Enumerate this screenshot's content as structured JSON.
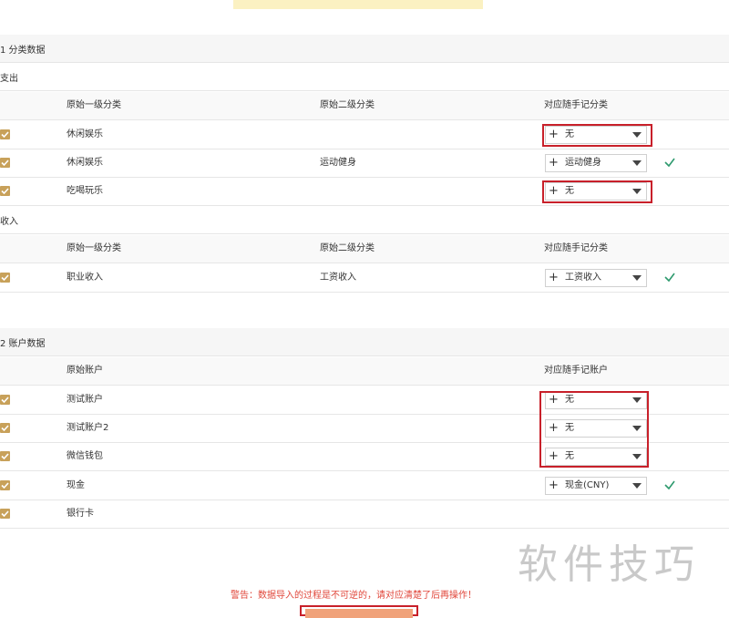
{
  "categories_section": {
    "title": "1 分类数据",
    "expense": {
      "group_label": "支出",
      "headers": [
        "原始一级分类",
        "原始二级分类",
        "对应随手记分类"
      ],
      "rows": [
        {
          "level1": "休闲娱乐",
          "level2": "",
          "mapped": "无",
          "matched": false
        },
        {
          "level1": "休闲娱乐",
          "level2": "运动健身",
          "mapped": "运动健身",
          "matched": true
        },
        {
          "level1": "吃喝玩乐",
          "level2": "",
          "mapped": "无",
          "matched": false
        }
      ]
    },
    "income": {
      "group_label": "收入",
      "headers": [
        "原始一级分类",
        "原始二级分类",
        "对应随手记分类"
      ],
      "rows": [
        {
          "level1": "职业收入",
          "level2": "工资收入",
          "mapped": "工资收入",
          "matched": true
        }
      ]
    }
  },
  "accounts_section": {
    "title": "2 账户数据",
    "headers": [
      "原始账户",
      "对应随手记账户"
    ],
    "rows": [
      {
        "account": "测试账户",
        "mapped": "无",
        "matched": false
      },
      {
        "account": "测试账户2",
        "mapped": "无",
        "matched": false
      },
      {
        "account": "微信钱包",
        "mapped": "无",
        "matched": false
      },
      {
        "account": "现金",
        "mapped": "现金(CNY)",
        "matched": true
      },
      {
        "account": "银行卡",
        "mapped": "",
        "matched": false
      }
    ]
  },
  "warning": "警告：数据导入的过程是不可逆的，请对应清楚了后再操作！",
  "watermark": "软件技巧",
  "colors": {
    "checkbox": "#c8a15a",
    "highlight_box": "#c8202a",
    "warning_text": "#e0463a",
    "matched_check": "#2e9a6e",
    "button": "#f0a27a"
  }
}
